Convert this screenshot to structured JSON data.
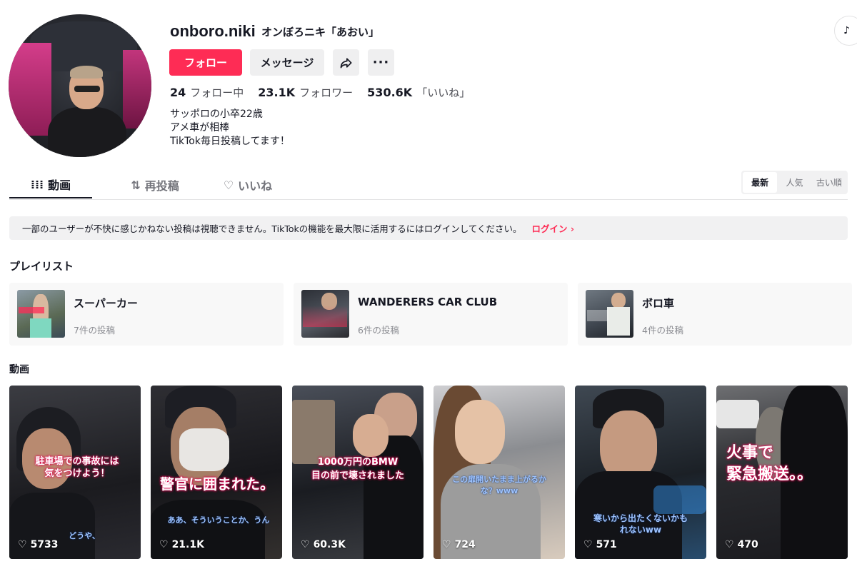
{
  "profile": {
    "username": "onboro.niki",
    "nickname": "オンぼろニキ「あおい」",
    "follow_label": "フォロー",
    "message_label": "メッセージ",
    "more_label": "···",
    "following_count": "24",
    "following_label": "フォロー中",
    "followers_count": "23.1K",
    "followers_label": "フォロワー",
    "likes_count": "530.6K",
    "likes_label": "「いいね」",
    "bio": [
      "サッポロの小卒22歳",
      "アメ車が相棒",
      "TikTok毎日投稿してます！"
    ]
  },
  "tabs": {
    "videos": "動画",
    "reposts": "再投稿",
    "liked": "いいね"
  },
  "sort": {
    "latest": "最新",
    "popular": "人気",
    "oldest": "古い順"
  },
  "notice": {
    "text": "一部のユーザーが不快に感じかねない投稿は視聴できません。TikTokの機能を最大限に活用するにはログインしてください。",
    "login": "ログイン"
  },
  "playlists_title": "プレイリスト",
  "playlists": [
    {
      "name": "スーパーカー",
      "count": "7件の投稿",
      "thumb_text": ""
    },
    {
      "name": "WANDERERS CAR CLUB",
      "count": "6件の投稿",
      "thumb_text": ""
    },
    {
      "name": "ボロ車",
      "count": "4件の投稿",
      "thumb_text": ""
    }
  ],
  "videos_title": "動画",
  "videos": [
    {
      "caption": "駐車場での事故には\n気をつけよう！",
      "subtitle": "どうや、",
      "likes": "5733"
    },
    {
      "caption": "警官に囲まれた。",
      "subtitle": "ああ、そういうことか、うん",
      "likes": "21.1K"
    },
    {
      "caption": "1000万円のBMW\n目の前で壊されました",
      "subtitle": "",
      "likes": "60.3K"
    },
    {
      "caption": "",
      "subtitle": "この扉開いたまま上がるか\nな？www",
      "likes": "724"
    },
    {
      "caption": "",
      "subtitle": "寒いから出たくないかも\nれないww",
      "likes": "571"
    },
    {
      "caption": "火事で\n緊急搬送。。",
      "subtitle": "",
      "likes": "470"
    }
  ],
  "colors": {
    "accent": "#fe2c55",
    "text": "#161823",
    "muted": "#73747b"
  }
}
